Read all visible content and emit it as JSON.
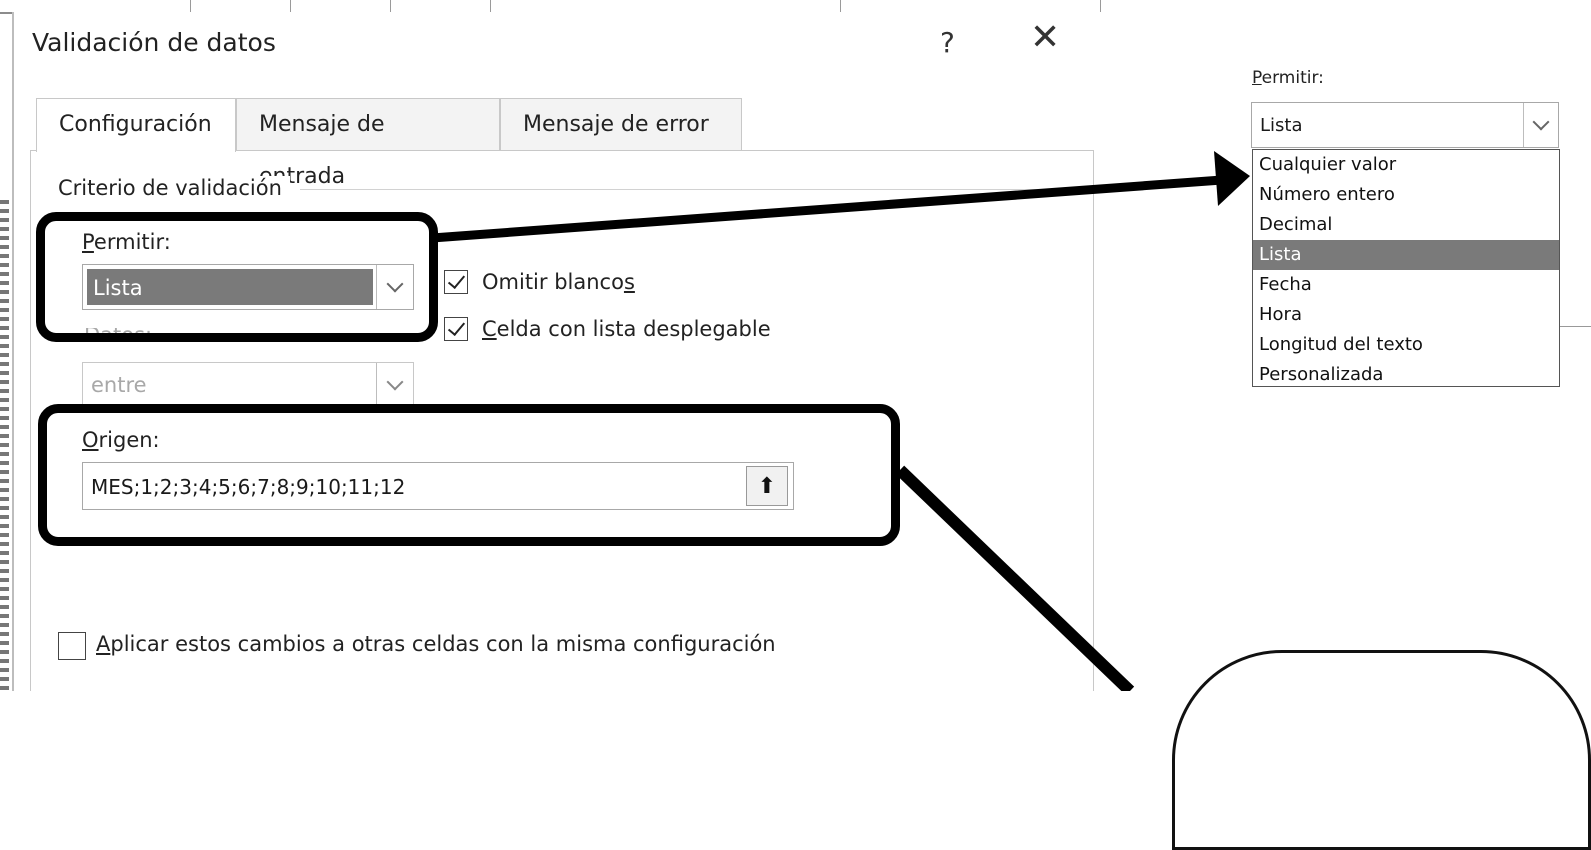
{
  "dialog": {
    "title": "Validación de datos",
    "help_glyph": "?",
    "close_glyph": "✕"
  },
  "tabs": [
    {
      "label": "Configuración",
      "active": true
    },
    {
      "label": "Mensaje de entrada",
      "active": false
    },
    {
      "label": "Mensaje de error",
      "active": false
    }
  ],
  "criteria": {
    "group_label": "Criterio de validación",
    "allow_label_first": "P",
    "allow_label_rest": "ermitir:",
    "allow_value": "Lista",
    "data_label": "Datos:",
    "data_value": "entre",
    "ignore_blank_label_main": "Omitir blanco",
    "ignore_blank_label_key": "s",
    "ignore_blank_checked": true,
    "dropdown_label_key": "C",
    "dropdown_label_rest": "elda con lista desplegable",
    "dropdown_checked": true,
    "source_label_key": "O",
    "source_label_rest": "rigen:",
    "source_value": "MES;1;2;3;4;5;6;7;8;9;10;11;12",
    "source_button_glyph": "⬆"
  },
  "apply_all": {
    "label_key": "A",
    "label_rest": "plicar estos cambios a otras celdas con la misma configuración",
    "checked": false
  },
  "popout": {
    "label_first": "P",
    "label_rest": "ermitir:",
    "value": "Lista",
    "options": [
      "Cualquier valor",
      "Número entero",
      "Decimal",
      "Lista",
      "Fecha",
      "Hora",
      "Longitud del texto",
      "Personalizada"
    ],
    "selected": "Lista"
  },
  "colors": {
    "selection": "#7a7a7a",
    "callout": "#000000"
  }
}
